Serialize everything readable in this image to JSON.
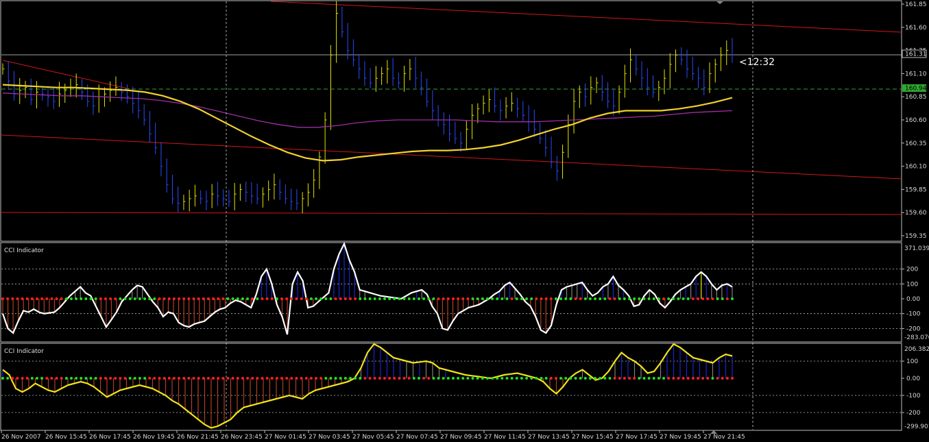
{
  "colors": {
    "background": "#000000",
    "frame": "#c0c0c0",
    "grid": "#bfbfbf",
    "price_bar": "#e6e600",
    "price_bar_down": "#2a4cff",
    "ma_fast": "#f2d22e",
    "ma_slow": "#a02ea8",
    "trend_line": "#d01818",
    "signal_line": "#2ea82e",
    "cci_line_1": "#ffffff",
    "cci_line_2": "#f2e21a",
    "hist_red": "#b04020",
    "hist_blue": "#1a24d0",
    "hist_yellow": "#e6e600",
    "dot_red": "#ff2020",
    "dot_green": "#20e020"
  },
  "price_panel": {
    "current_price": "161.31",
    "signal_price": "160.94",
    "countdown": "<12:32",
    "y_ticks": [
      "161.85",
      "161.60",
      "161.35",
      "161.10",
      "160.85",
      "160.60",
      "160.35",
      "160.10",
      "159.85",
      "159.60",
      "159.35"
    ]
  },
  "cci_panel_1": {
    "title": "CCI Indicator",
    "max_label": "371.0392",
    "min_label": "-283.070",
    "y_ticks": [
      "200",
      "100",
      "0.00",
      "-100",
      "-200"
    ]
  },
  "cci_panel_2": {
    "title": "CCI Indicator",
    "max_label": "206.3826",
    "min_label": "-299.901",
    "y_ticks": [
      "100",
      "0.00",
      "-100",
      "-200"
    ]
  },
  "x_axis": {
    "labels": [
      "26 Nov 2007",
      "26 Nov 15:45",
      "26 Nov 17:45",
      "26 Nov 19:45",
      "26 Nov 21:45",
      "26 Nov 23:45",
      "27 Nov 01:45",
      "27 Nov 03:45",
      "27 Nov 05:45",
      "27 Nov 07:45",
      "27 Nov 09:45",
      "27 Nov 11:45",
      "27 Nov 13:45",
      "27 Nov 15:45",
      "27 Nov 17:45",
      "27 Nov 19:45",
      "27 Nov 21:45"
    ]
  },
  "chart_data": [
    {
      "type": "line",
      "title": "",
      "ylim": [
        159.35,
        161.88
      ],
      "series": [
        {
          "values": [
            161.15,
            161.02,
            160.88,
            160.92,
            160.95,
            160.82,
            160.9,
            160.88,
            160.85,
            160.8,
            160.88,
            160.92,
            160.95,
            160.98,
            160.9,
            160.8,
            160.75,
            160.85,
            160.88,
            160.92,
            160.95,
            160.9,
            160.85,
            160.78,
            160.7,
            160.6,
            160.45,
            160.3,
            160.1,
            159.9,
            159.75,
            159.7,
            159.72,
            159.75,
            159.78,
            159.75,
            159.72,
            159.8,
            159.78,
            159.75,
            159.72,
            159.8,
            159.85,
            159.82,
            159.78,
            159.75,
            159.8,
            159.85,
            159.9,
            159.82,
            159.75,
            159.72,
            159.7,
            159.75,
            159.82,
            159.95,
            160.2,
            160.6,
            161.3,
            161.75,
            161.55,
            161.35,
            161.25,
            161.15,
            161.05,
            161.0,
            161.05,
            161.1,
            161.15,
            161.05,
            161.0,
            161.1,
            161.15,
            161.05,
            160.95,
            160.8,
            160.7,
            160.6,
            160.55,
            160.45,
            160.4,
            160.35,
            160.5,
            160.65,
            160.72,
            160.78,
            160.82,
            160.75,
            160.7,
            160.75,
            160.78,
            160.72,
            160.65,
            160.58,
            160.5,
            160.4,
            160.3,
            160.15,
            160.05,
            160.25,
            160.55,
            160.8,
            160.9,
            160.85,
            160.95,
            161.0,
            160.9,
            160.8,
            160.75,
            160.9,
            161.1,
            161.25,
            161.15,
            161.05,
            160.95,
            160.9,
            160.95,
            161.05,
            161.2,
            161.3,
            161.25,
            161.15,
            161.1,
            161.05,
            160.95,
            161.1,
            161.2,
            161.3,
            161.35,
            161.3
          ],
          "name": ""
        },
        {
          "name": "",
          "values": [
            160.98,
            160.97,
            160.96,
            160.95,
            160.95,
            160.94,
            160.93,
            160.92,
            160.9,
            160.86,
            160.8,
            160.72,
            160.62,
            160.52,
            160.42,
            160.33,
            160.25,
            160.19,
            160.16,
            160.17,
            160.2,
            160.22,
            160.24,
            160.26,
            160.27,
            160.27,
            160.28,
            160.3,
            160.33,
            160.38,
            160.44,
            160.5,
            160.55,
            160.62,
            160.67,
            160.7,
            160.7,
            160.7,
            160.72,
            160.75,
            160.79,
            160.84
          ]
        },
        {
          "name": "",
          "values": [
            160.89,
            160.88,
            160.87,
            160.86,
            160.86,
            160.85,
            160.84,
            160.83,
            160.81,
            160.78,
            160.74,
            160.69,
            160.64,
            160.59,
            160.55,
            160.52,
            160.52,
            160.54,
            160.57,
            160.59,
            160.6,
            160.6,
            160.6,
            160.6,
            160.59,
            160.58,
            160.58,
            160.58,
            160.59,
            160.6,
            160.61,
            160.62,
            160.63,
            160.64,
            160.66,
            160.68,
            160.69,
            160.7
          ]
        }
      ]
    },
    {
      "type": "bar",
      "title": "CCI Indicator",
      "ylim": [
        -283.07,
        371.04
      ],
      "series": [
        {
          "name": "",
          "values": [
            -100,
            -200,
            -230,
            -150,
            -80,
            -90,
            -70,
            -90,
            -100,
            -95,
            -90,
            -60,
            -20,
            20,
            50,
            80,
            40,
            20,
            -50,
            -120,
            -190,
            -140,
            -90,
            -20,
            20,
            60,
            90,
            80,
            30,
            -20,
            -60,
            -120,
            -90,
            -100,
            -160,
            -180,
            -190,
            -170,
            -160,
            -150,
            -120,
            -90,
            -70,
            -60,
            -30,
            -10,
            -20,
            -40,
            -60,
            30,
            150,
            200,
            100,
            -40,
            -120,
            -240,
            100,
            180,
            120,
            -60,
            -50,
            -20,
            10,
            40,
            200,
            300,
            370,
            260,
            180,
            60,
            50,
            40,
            30,
            20,
            15,
            10,
            5,
            0,
            20,
            40,
            50,
            60,
            30,
            -50,
            -100,
            -200,
            -210,
            -150,
            -100,
            -80,
            -60,
            -50,
            -40,
            -20,
            0,
            30,
            50,
            90,
            110,
            70,
            30,
            -20,
            -50,
            -120,
            -210,
            -230,
            -180,
            -40,
            60,
            80,
            90,
            100,
            110,
            60,
            20,
            40,
            80,
            100,
            150,
            90,
            60,
            20,
            -50,
            -40,
            20,
            60,
            30,
            -30,
            -60,
            -20,
            30,
            60,
            80,
            100,
            150,
            180,
            150,
            100,
            60,
            90,
            100,
            80
          ]
        }
      ]
    },
    {
      "type": "bar",
      "title": "CCI Indicator",
      "ylim": [
        -299.9,
        206.38
      ],
      "series": [
        {
          "name": "",
          "values": [
            50,
            20,
            -60,
            -80,
            -60,
            -30,
            -50,
            -70,
            -80,
            -60,
            -40,
            -30,
            -20,
            -30,
            -50,
            -80,
            -110,
            -90,
            -70,
            -60,
            -50,
            -40,
            -50,
            -60,
            -80,
            -100,
            -130,
            -150,
            -180,
            -210,
            -240,
            -270,
            -290,
            -280,
            -260,
            -240,
            -200,
            -170,
            -160,
            -150,
            -140,
            -130,
            -120,
            -110,
            -100,
            -110,
            -120,
            -90,
            -70,
            -60,
            -50,
            -40,
            -30,
            -20,
            0,
            60,
            150,
            200,
            180,
            150,
            120,
            110,
            100,
            90,
            95,
            100,
            90,
            60,
            50,
            40,
            30,
            20,
            15,
            10,
            5,
            0,
            10,
            20,
            25,
            30,
            20,
            10,
            0,
            -20,
            -60,
            -90,
            -50,
            0,
            30,
            50,
            20,
            -10,
            0,
            40,
            100,
            150,
            120,
            100,
            70,
            30,
            40,
            90,
            150,
            200,
            180,
            150,
            120,
            110,
            100,
            90,
            120,
            140,
            130
          ]
        }
      ]
    }
  ]
}
